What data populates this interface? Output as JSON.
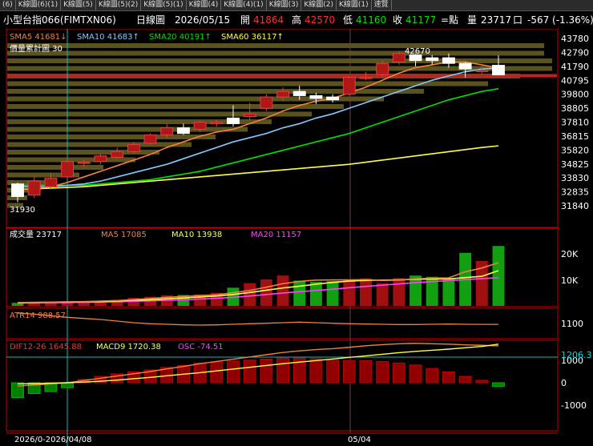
{
  "tabs": [
    "(6)",
    "K線圖(6)(1)",
    "K線圖(5)",
    "K線圖(5)(2)",
    "K線圖(5)(1)",
    "K線圖(4)",
    "K線圖(4)(1)",
    "K線圖(3)",
    "K線圖(2)",
    "K線圖(1)",
    "速覽"
  ],
  "header": {
    "symbol": "小型台指066(FIMTXN06)",
    "period": "日線圖",
    "date": "2026/05/15",
    "open_label": "開",
    "open": "41864",
    "high_label": "高",
    "high": "42570",
    "low_label": "低",
    "low": "41160",
    "close_label": "收",
    "close": "41177",
    "unit_label": "=點",
    "vol_label": "量",
    "vol": "23717",
    "box": "口",
    "change": "-567 (-1.36%)"
  },
  "colors": {
    "up": "#e02020",
    "down": "#00a000",
    "sma5": "#f08040",
    "sma10": "#80c8ff",
    "sma20": "#00e000",
    "sma60": "#ffff40",
    "ma20vol": "#ff40ff",
    "cursor": "#00c0c0",
    "border": "#c00000"
  },
  "price_legend": {
    "sma5": "SMA5 41681↓",
    "sma10": "SMA10 41683↑",
    "sma20": "SMA20 40191↑",
    "sma60": "SMA60 36117↑",
    "profile": "價量累計圖 30",
    "high_mark": "42670",
    "low_mark": "31930"
  },
  "price_axis": [
    "43780",
    "42790",
    "41790",
    "40795",
    "39800",
    "38805",
    "37810",
    "36815",
    "35820",
    "34825",
    "33830",
    "32835",
    "31840"
  ],
  "volume_legend": {
    "vol": "成交量 23717",
    "ma5": "MA5 17085",
    "ma10": "MA10 13938",
    "ma20": "MA20 11157"
  },
  "volume_axis": [
    "20K",
    "10K"
  ],
  "atr_legend": "ATR14 988.57",
  "atr_axis": "1100",
  "macd_legend": {
    "dif": "DIF12-26 1645.88",
    "macd": "MACD9 1720.38",
    "osc": "OSC -74.51"
  },
  "macd_axis": [
    "1000",
    "0",
    "-1000"
  ],
  "macd_marker": "1206.3",
  "date_axis": {
    "left": "2026/0-2026/04/08",
    "mid": "05/04"
  },
  "candles": [
    {
      "o": 33400,
      "c": 32500,
      "h": 33500,
      "l": 32100
    },
    {
      "o": 32600,
      "c": 33600,
      "h": 33900,
      "l": 32400
    },
    {
      "o": 33200,
      "c": 33800,
      "h": 34200,
      "l": 33000
    },
    {
      "o": 33900,
      "c": 35000,
      "h": 35300,
      "l": 33700
    },
    {
      "o": 34900,
      "c": 34950,
      "h": 35100,
      "l": 34600
    },
    {
      "o": 35000,
      "c": 35400,
      "h": 35600,
      "l": 34800
    },
    {
      "o": 35300,
      "c": 35700,
      "h": 36000,
      "l": 35200
    },
    {
      "o": 35700,
      "c": 36200,
      "h": 36400,
      "l": 35600
    },
    {
      "o": 36300,
      "c": 36900,
      "h": 37000,
      "l": 36200
    },
    {
      "o": 36900,
      "c": 37400,
      "h": 37700,
      "l": 36700
    },
    {
      "o": 37400,
      "c": 37000,
      "h": 37700,
      "l": 36900
    },
    {
      "o": 37300,
      "c": 37800,
      "h": 37900,
      "l": 37100
    },
    {
      "o": 37700,
      "c": 37800,
      "h": 38000,
      "l": 37500
    },
    {
      "o": 38100,
      "c": 37700,
      "h": 39000,
      "l": 37500
    },
    {
      "o": 38200,
      "c": 38400,
      "h": 39200,
      "l": 37900
    },
    {
      "o": 38800,
      "c": 39600,
      "h": 39800,
      "l": 38600
    },
    {
      "o": 39600,
      "c": 40000,
      "h": 40300,
      "l": 39300
    },
    {
      "o": 40000,
      "c": 39700,
      "h": 40400,
      "l": 39400
    },
    {
      "o": 39700,
      "c": 39500,
      "h": 39900,
      "l": 39100
    },
    {
      "o": 39600,
      "c": 39400,
      "h": 39800,
      "l": 39200
    },
    {
      "o": 39800,
      "c": 41000,
      "h": 41100,
      "l": 39700
    },
    {
      "o": 41000,
      "c": 41000,
      "h": 41400,
      "l": 40800
    },
    {
      "o": 41200,
      "c": 42000,
      "h": 42200,
      "l": 41000
    },
    {
      "o": 42100,
      "c": 42700,
      "h": 42900,
      "l": 41900
    },
    {
      "o": 42600,
      "c": 42200,
      "h": 42670,
      "l": 41800
    },
    {
      "o": 42400,
      "c": 42200,
      "h": 42600,
      "l": 41900
    },
    {
      "o": 42400,
      "c": 42000,
      "h": 42700,
      "l": 41700
    },
    {
      "o": 42000,
      "c": 41600,
      "h": 42100,
      "l": 41000
    },
    {
      "o": 41500,
      "c": 41500,
      "h": 41900,
      "l": 41200
    },
    {
      "o": 41864,
      "c": 41177,
      "h": 42570,
      "l": 41160
    }
  ],
  "volumes": [
    1200,
    1400,
    1500,
    1800,
    1600,
    2000,
    2400,
    3200,
    3600,
    4200,
    4300,
    4500,
    5200,
    7200,
    9000,
    10500,
    12000,
    10000,
    9500,
    9800,
    10300,
    10800,
    9000,
    11000,
    12000,
    11500,
    10800,
    21000,
    17800,
    23717
  ],
  "ma5_vol": [
    1300,
    1400,
    1500,
    1600,
    1700,
    1900,
    2100,
    2500,
    2900,
    3400,
    3700,
    4100,
    4400,
    5200,
    6100,
    7400,
    8800,
    9700,
    10200,
    10300,
    10300,
    10400,
    10100,
    10200,
    10700,
    11000,
    11100,
    13500,
    15000,
    17085
  ],
  "ma10_vol": [
    1200,
    1300,
    1400,
    1500,
    1600,
    1700,
    1900,
    2200,
    2400,
    2800,
    3100,
    3500,
    3900,
    4500,
    5300,
    6200,
    7100,
    7800,
    8600,
    9300,
    9800,
    10100,
    10200,
    10300,
    10500,
    10600,
    10700,
    11200,
    11700,
    13938
  ],
  "ma20_vol": [
    1100,
    1200,
    1300,
    1300,
    1400,
    1500,
    1600,
    1800,
    2000,
    2200,
    2400,
    2700,
    3000,
    3400,
    3900,
    4500,
    5100,
    5600,
    6100,
    6600,
    7200,
    7700,
    8200,
    8700,
    9200,
    9600,
    10000,
    10400,
    10800,
    11157
  ],
  "atr": [
    1200,
    1180,
    1150,
    1120,
    1100,
    1080,
    1050,
    1020,
    1000,
    990,
    980,
    975,
    980,
    990,
    1000,
    1010,
    1020,
    1030,
    1020,
    1010,
    1000,
    995,
    990,
    985,
    985,
    990,
    995,
    990,
    988,
    988.57
  ],
  "dif": [
    -150,
    -100,
    -50,
    0,
    100,
    200,
    300,
    400,
    500,
    620,
    730,
    850,
    950,
    1050,
    1150,
    1250,
    1350,
    1420,
    1480,
    1520,
    1580,
    1650,
    1700,
    1740,
    1760,
    1740,
    1720,
    1690,
    1670,
    1645.88
  ],
  "macd_line": [
    -50,
    -40,
    -20,
    0,
    30,
    70,
    120,
    180,
    240,
    310,
    380,
    450,
    530,
    610,
    690,
    770,
    850,
    920,
    990,
    1060,
    1130,
    1200,
    1270,
    1340,
    1400,
    1450,
    1500,
    1560,
    1620,
    1720.38
  ],
  "osc": [
    -300,
    -220,
    -180,
    -100,
    70,
    130,
    180,
    220,
    260,
    310,
    350,
    400,
    420,
    440,
    460,
    480,
    500,
    500,
    490,
    460,
    450,
    450,
    430,
    400,
    360,
    290,
    220,
    130,
    50,
    -74.51
  ],
  "sma5": [
    33000,
    33100,
    33200,
    33500,
    33900,
    34300,
    34700,
    35100,
    35500,
    36000,
    36400,
    36800,
    37100,
    37300,
    37700,
    38100,
    38600,
    39000,
    39300,
    39500,
    39900,
    40300,
    40800,
    41300,
    41700,
    41900,
    42100,
    42100,
    41900,
    41681
  ],
  "sma10": [
    33200,
    33200,
    33200,
    33300,
    33400,
    33600,
    33900,
    34200,
    34500,
    34800,
    35200,
    35600,
    36000,
    36400,
    36700,
    37000,
    37400,
    37700,
    38100,
    38400,
    38800,
    39200,
    39600,
    40000,
    40400,
    40800,
    41100,
    41400,
    41600,
    41683
  ],
  "sma20": [
    33300,
    33300,
    33300,
    33300,
    33300,
    33400,
    33500,
    33600,
    33700,
    33900,
    34100,
    34300,
    34600,
    34900,
    35200,
    35500,
    35800,
    36100,
    36400,
    36700,
    37000,
    37400,
    37800,
    38200,
    38600,
    39000,
    39400,
    39700,
    40000,
    40191
  ],
  "sma60": [
    33000,
    33050,
    33100,
    33150,
    33200,
    33300,
    33400,
    33500,
    33600,
    33700,
    33800,
    33900,
    34000,
    34100,
    34200,
    34300,
    34400,
    34500,
    34600,
    34700,
    34800,
    34950,
    35100,
    35250,
    35400,
    35550,
    35700,
    35850,
    36000,
    36117
  ]
}
